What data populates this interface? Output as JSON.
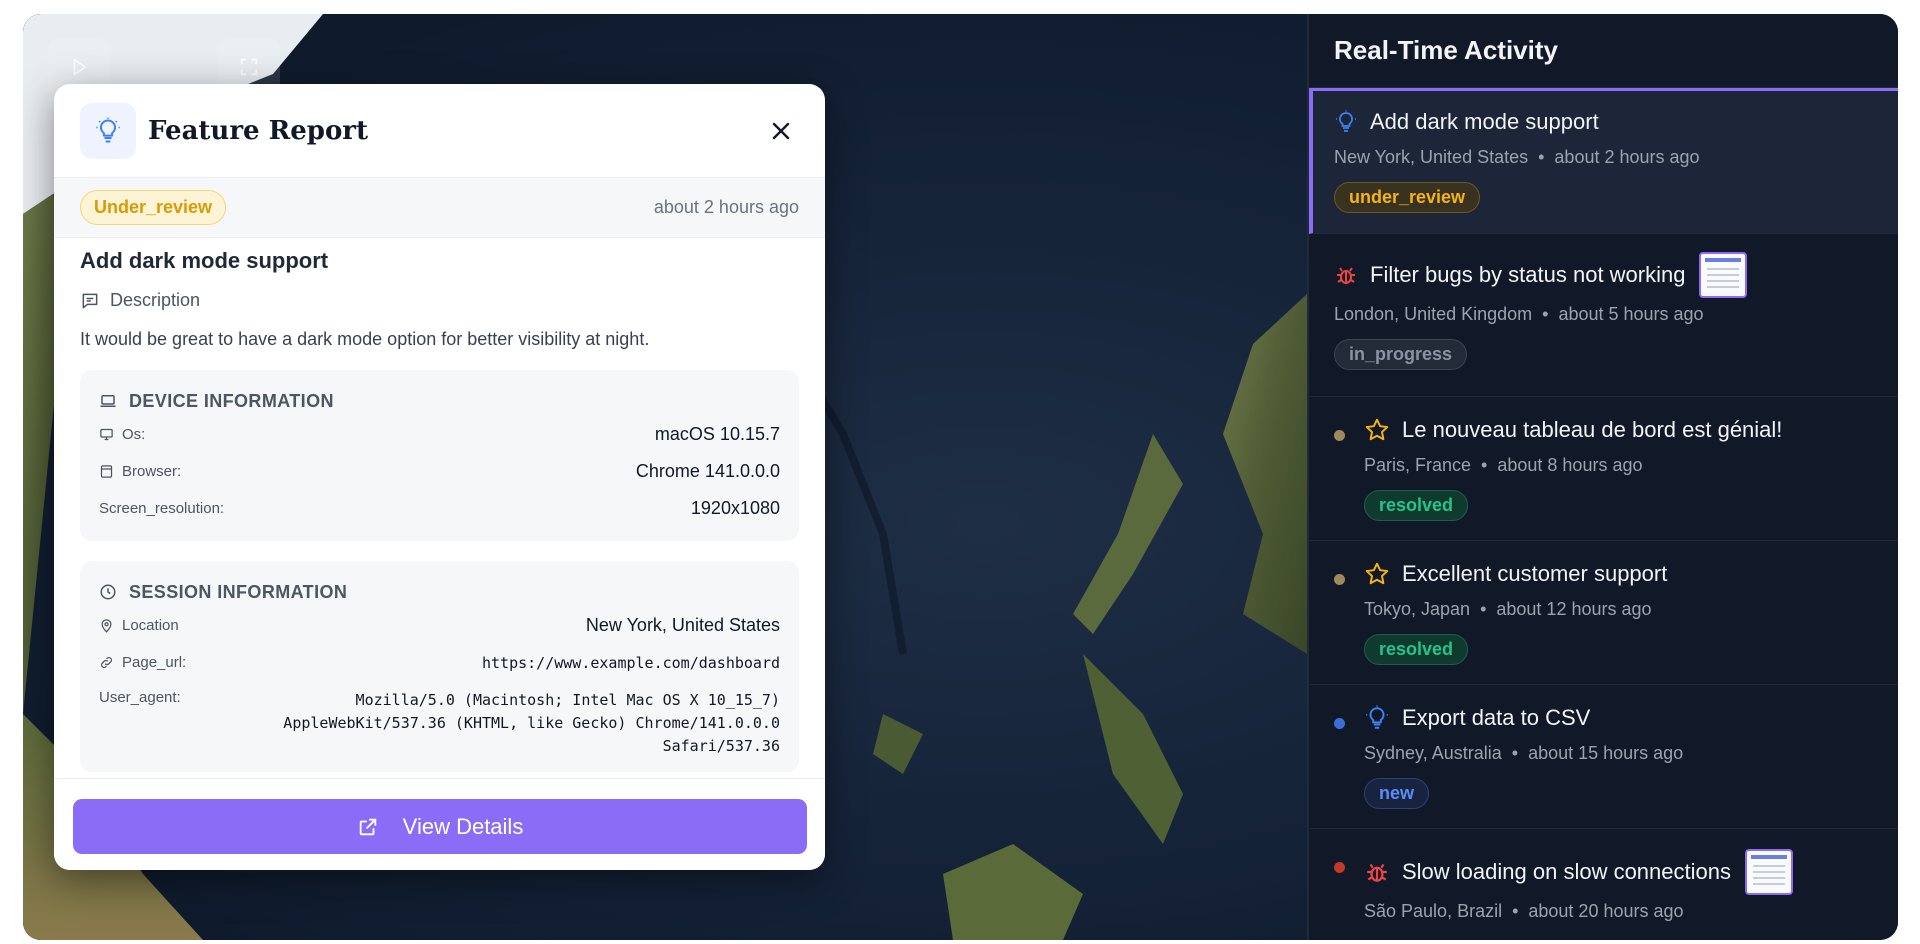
{
  "modal": {
    "title": "Feature Report",
    "status": "Under_review",
    "time": "about 2 hours ago",
    "report_title": "Add dark mode support",
    "description_label": "Description",
    "description": "It would be great to have a dark mode option for better visibility at night.",
    "device": {
      "heading": "DEVICE INFORMATION",
      "os_label": "Os:",
      "os": "macOS 10.15.7",
      "browser_label": "Browser:",
      "browser": "Chrome 141.0.0.0",
      "screen_label": "Screen_resolution:",
      "screen": "1920x1080"
    },
    "session": {
      "heading": "SESSION INFORMATION",
      "location_label": "Location",
      "location": "New York, United States",
      "page_url_label": "Page_url:",
      "page_url": "https://www.example.com/dashboard",
      "user_agent_label": "User_agent:",
      "user_agent": "Mozilla/5.0 (Macintosh; Intel Mac OS X 10_15_7) AppleWebKit/537.36 (KHTML, like Gecko) Chrome/141.0.0.0 Safari/537.36"
    },
    "view_button": "View Details"
  },
  "panel": {
    "title": "Real-Time Activity",
    "items": [
      {
        "icon": "lightbulb-icon",
        "title": "Add dark mode support",
        "location": "New York, United States",
        "time": "about 2 hours ago",
        "status": "under_review",
        "active": true
      },
      {
        "icon": "bug-icon",
        "title": "Filter bugs by status not working",
        "location": "London, United Kingdom",
        "time": "about 5 hours ago",
        "status": "in_progress",
        "has_thumbnail": true
      },
      {
        "icon": "star-icon",
        "title": "Le nouveau tableau de bord est génial!",
        "location": "Paris, France",
        "time": "about 8 hours ago",
        "status": "resolved",
        "dot_color": "#a08a5c"
      },
      {
        "icon": "star-icon",
        "title": "Excellent customer support",
        "location": "Tokyo, Japan",
        "time": "about 12 hours ago",
        "status": "resolved",
        "dot_color": "#a08a5c"
      },
      {
        "icon": "lightbulb-icon",
        "title": "Export data to CSV",
        "location": "Sydney, Australia",
        "time": "about 15 hours ago",
        "status": "new",
        "dot_color": "#3b6fd8"
      },
      {
        "icon": "bug-icon",
        "title": "Slow loading on slow connections",
        "location": "São Paulo, Brazil",
        "time": "about 20 hours ago",
        "dot_color": "#c0392b",
        "has_thumbnail": true
      }
    ],
    "separator": "•"
  },
  "colors": {
    "accent": "#8b6cf6",
    "review": "#f5b316",
    "resolved": "#22c58b",
    "new": "#5b8cf6",
    "bug": "#ef4444",
    "idea": "#3b82f6"
  }
}
